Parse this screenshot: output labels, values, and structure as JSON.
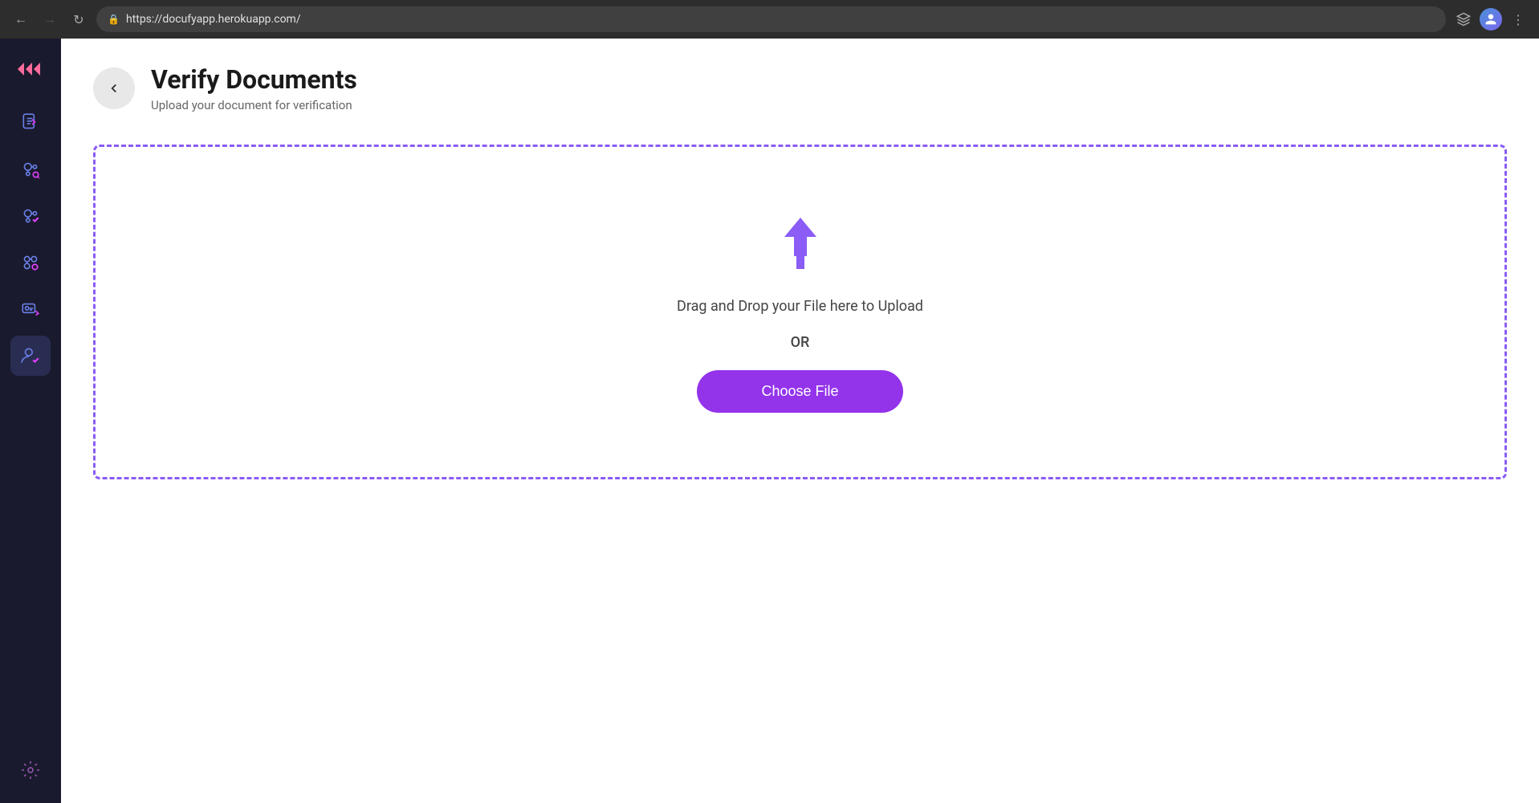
{
  "browser": {
    "url": "https://docufyapp.herokuapp.com/",
    "back_disabled": false,
    "forward_disabled": true
  },
  "sidebar": {
    "logo_label": ">>",
    "items": [
      {
        "id": "documents",
        "icon": "document-edit-icon",
        "active": false
      },
      {
        "id": "network-search",
        "icon": "network-search-icon",
        "active": false
      },
      {
        "id": "verify-check",
        "icon": "verify-check-icon",
        "active": false
      },
      {
        "id": "network-cog",
        "icon": "network-cog-icon",
        "active": false
      },
      {
        "id": "id-verify",
        "icon": "id-verify-icon",
        "active": false
      },
      {
        "id": "user-check",
        "icon": "user-check-icon",
        "active": true
      }
    ],
    "settings_label": "settings"
  },
  "page": {
    "title": "Verify Documents",
    "subtitle": "Upload your document for verification",
    "back_button_label": "back"
  },
  "upload": {
    "drag_drop_text": "Drag and Drop your File here to Upload",
    "or_text": "OR",
    "choose_file_label": "Choose File"
  }
}
